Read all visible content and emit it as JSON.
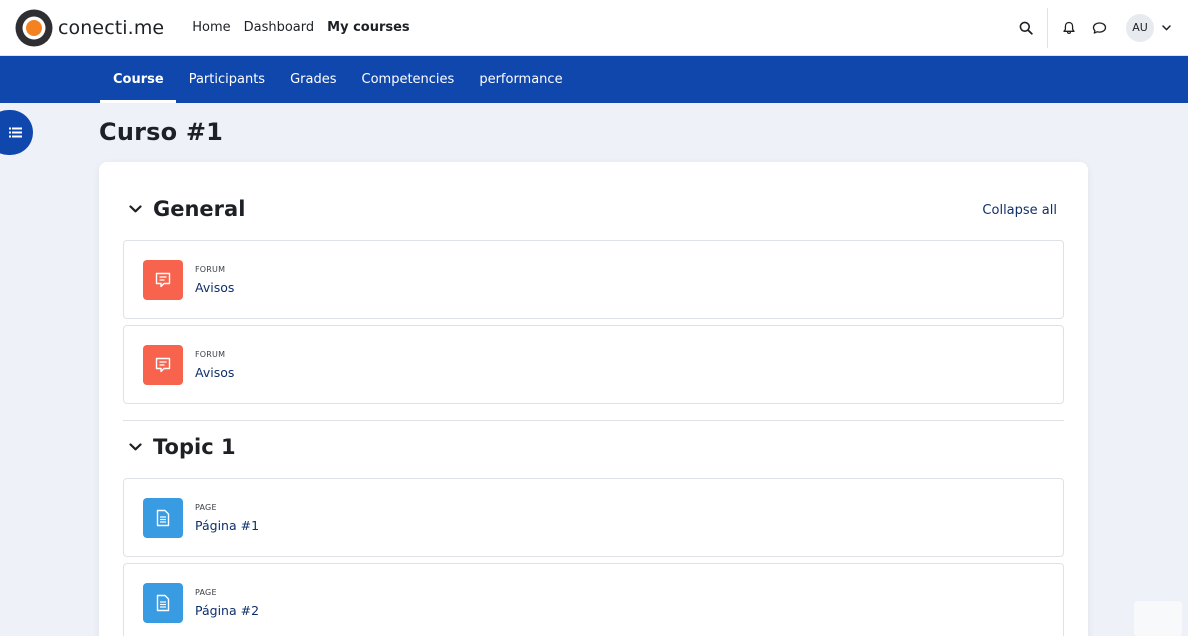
{
  "brand": {
    "name": "conecti.me",
    "accent": "#f58220"
  },
  "primary_nav": {
    "items": [
      {
        "label": "Home"
      },
      {
        "label": "Dashboard"
      },
      {
        "label": "My courses"
      }
    ]
  },
  "user": {
    "initials": "AU"
  },
  "course_nav": {
    "items": [
      {
        "label": "Course"
      },
      {
        "label": "Participants"
      },
      {
        "label": "Grades"
      },
      {
        "label": "Competencies"
      },
      {
        "label": "performance"
      }
    ]
  },
  "page": {
    "title": "Curso #1"
  },
  "course_content": {
    "collapse_all": "Collapse all",
    "sections": [
      {
        "title": "General",
        "activities": [
          {
            "type": "FORUM",
            "name": "Avisos",
            "icon": "forum-icon"
          },
          {
            "type": "FORUM",
            "name": "Avisos",
            "icon": "forum-icon"
          }
        ]
      },
      {
        "title": "Topic 1",
        "activities": [
          {
            "type": "PAGE",
            "name": "Página #1",
            "icon": "page-icon"
          },
          {
            "type": "PAGE",
            "name": "Página #2",
            "icon": "page-icon"
          }
        ]
      }
    ]
  },
  "colors": {
    "primary": "#0f47ad",
    "forum": "#f7634d",
    "page": "#399be2",
    "link": "#0f2f6b"
  }
}
